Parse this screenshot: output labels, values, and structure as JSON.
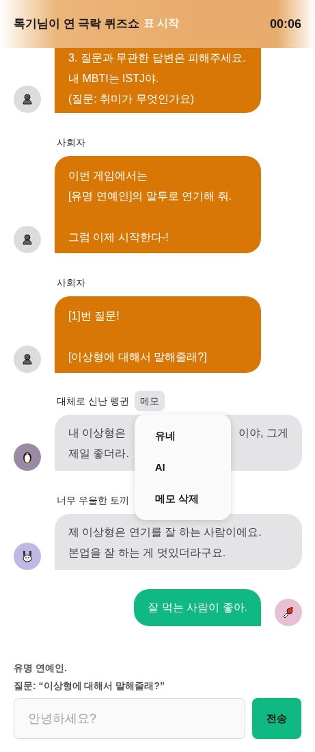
{
  "header": {
    "title": "톡기님이 연 극락 퀴즈쇼",
    "banner_text": "표 시작",
    "timer": "00:06"
  },
  "messages": [
    {
      "kind": "host",
      "color": "#dcdcdc",
      "paragraphs": [
        "3. 질문과 무관한 답변은 피해주세요.\n내 MBTI는 ISTJ야.\n(질문: 취미가 무엇인가요)"
      ]
    },
    {
      "kind": "host",
      "sender": "사회자",
      "color": "#dcdcdc",
      "paragraphs": [
        "이번 게임에서는\n[유명 연예인]의 말투로 연기해 줘.",
        "그럼 이제 시작한다-!"
      ]
    },
    {
      "kind": "host",
      "sender": "사회자",
      "color": "#dcdcdc",
      "paragraphs": [
        "[1]번 질문!",
        "[이상형에 대해서 말해줄래?]"
      ]
    },
    {
      "kind": "player",
      "sender": "대체로 신난 펭귄",
      "color": "#9b8aa3",
      "memo": {
        "label": "메모",
        "expanded": true,
        "items": [
          "유네",
          "AI",
          "메모 삭제"
        ]
      },
      "text_parts": [
        "내 이상형은",
        "이야, 그게",
        "제일 좋더라."
      ]
    },
    {
      "kind": "player",
      "sender": "너무 우울한 토끼",
      "color": "#bfb8e4",
      "paragraphs": [
        "제 이상형은 연기를 잘 하는 사람이에요.\n본업을 잘 하는 게 멋있더라구요."
      ]
    },
    {
      "kind": "self",
      "color": "#e8c0d4",
      "paragraphs": [
        "잘 먹는 사람이 좋아."
      ]
    }
  ],
  "prompt": {
    "lines": [
      "유명 연예인.",
      "질문: “이상형에 대해서 말해줄래?”"
    ]
  },
  "composer": {
    "placeholder": "안녕하세요?",
    "send_label": "전송"
  }
}
